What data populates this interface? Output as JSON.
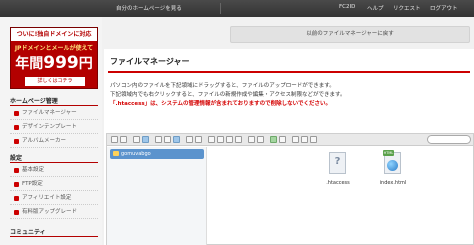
{
  "topbar": {
    "links": [
      "自分のホームページを見る",
      "FC2ID",
      "ヘルプ",
      "リクエスト",
      "ログアウト"
    ]
  },
  "sidebar": {
    "ad": {
      "top": "ついに!独自ドメインに対応",
      "mid": "JPドメインとメールが使えて",
      "price_prefix": "年間",
      "price_num": "999",
      "price_suffix": "円",
      "bottom": "詳しくはコチラ"
    },
    "sections": [
      {
        "title": "ホームページ管理",
        "items": [
          "ファイルマネージャー",
          "デザインテンプレート",
          "アルバムメーカー"
        ]
      },
      {
        "title": "設定",
        "items": [
          "基本設定",
          "FTP設定",
          "アフィリエイト設定",
          "有料版アップグレード"
        ]
      },
      {
        "title": "コミュニティ",
        "items": []
      }
    ]
  },
  "main": {
    "back_button": "以前のファイルマネージャーに戻す",
    "title": "ファイルマネージャー",
    "desc1": "パソコン内のファイルを下記領域にドラッグすると、ファイルのアップロードができます。",
    "desc2": "下記領域内でも右クリックすると、ファイルの新規作成や編集・アクセス制限などができます。",
    "warning": "「.htaccess」は、システムの管理情報が含まれておりますので削除しないでください。"
  },
  "file_manager": {
    "tree_root": "gomuvabgo",
    "files": [
      {
        "name": ".htaccess",
        "icon": "unknown-file-icon"
      },
      {
        "name": "index.html",
        "icon": "html-file-icon",
        "badge": "HTML"
      }
    ]
  },
  "colors": {
    "accent": "#cc0000",
    "selection": "#5b93cd"
  }
}
